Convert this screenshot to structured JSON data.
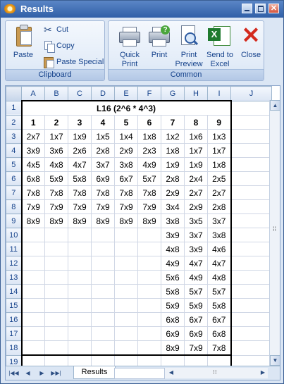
{
  "window": {
    "title": "Results"
  },
  "ribbon": {
    "clipboard": {
      "group_label": "Clipboard",
      "paste": "Paste",
      "cut": "Cut",
      "copy": "Copy",
      "paste_special": "Paste Special"
    },
    "common": {
      "group_label": "Common",
      "quick_print": [
        "Quick",
        "Print"
      ],
      "print": "Print",
      "print_preview": [
        "Print",
        "Preview"
      ],
      "send_to_excel": [
        "Send to",
        "Excel"
      ],
      "close": "Close"
    }
  },
  "sheet": {
    "columns": [
      "A",
      "B",
      "C",
      "D",
      "E",
      "F",
      "G",
      "H",
      "I",
      "J"
    ],
    "rows": [
      "1",
      "2",
      "3",
      "4",
      "5",
      "6",
      "7",
      "8",
      "9",
      "10",
      "11",
      "12",
      "13",
      "14",
      "15",
      "16",
      "17",
      "18",
      "19"
    ],
    "table_title": "L16 (2^6 * 4^3)",
    "header": [
      "1",
      "2",
      "3",
      "4",
      "5",
      "6",
      "7",
      "8",
      "9"
    ],
    "data": [
      [
        "2x7",
        "1x7",
        "1x9",
        "1x5",
        "1x4",
        "1x8",
        "1x2",
        "1x6",
        "1x3"
      ],
      [
        "3x9",
        "3x6",
        "2x6",
        "2x8",
        "2x9",
        "2x3",
        "1x8",
        "1x7",
        "1x7"
      ],
      [
        "4x5",
        "4x8",
        "4x7",
        "3x7",
        "3x8",
        "4x9",
        "1x9",
        "1x9",
        "1x8"
      ],
      [
        "6x8",
        "5x9",
        "5x8",
        "6x9",
        "6x7",
        "5x7",
        "2x8",
        "2x4",
        "2x5"
      ],
      [
        "7x8",
        "7x8",
        "7x8",
        "7x8",
        "7x8",
        "7x8",
        "2x9",
        "2x7",
        "2x7"
      ],
      [
        "7x9",
        "7x9",
        "7x9",
        "7x9",
        "7x9",
        "7x9",
        "3x4",
        "2x9",
        "2x8"
      ],
      [
        "8x9",
        "8x9",
        "8x9",
        "8x9",
        "8x9",
        "8x9",
        "3x8",
        "3x5",
        "3x7"
      ],
      [
        "",
        "",
        "",
        "",
        "",
        "",
        "3x9",
        "3x7",
        "3x8"
      ],
      [
        "",
        "",
        "",
        "",
        "",
        "",
        "4x8",
        "3x9",
        "4x6"
      ],
      [
        "",
        "",
        "",
        "",
        "",
        "",
        "4x9",
        "4x7",
        "4x7"
      ],
      [
        "",
        "",
        "",
        "",
        "",
        "",
        "5x6",
        "4x9",
        "4x8"
      ],
      [
        "",
        "",
        "",
        "",
        "",
        "",
        "5x8",
        "5x7",
        "5x7"
      ],
      [
        "",
        "",
        "",
        "",
        "",
        "",
        "5x9",
        "5x9",
        "5x8"
      ],
      [
        "",
        "",
        "",
        "",
        "",
        "",
        "6x8",
        "6x7",
        "6x7"
      ],
      [
        "",
        "",
        "",
        "",
        "",
        "",
        "6x9",
        "6x9",
        "6x8"
      ],
      [
        "",
        "",
        "",
        "",
        "",
        "",
        "8x9",
        "7x9",
        "7x8"
      ]
    ],
    "tab_label": "Results"
  },
  "icons": {
    "paste": "clipboard-icon",
    "cut": "scissors-icon",
    "copy": "copy-icon",
    "paste_special": "paste-special-icon",
    "quick_print": "printer-icon",
    "print": "printer-question-icon",
    "print_preview": "magnifier-page-icon",
    "send_to_excel": "excel-icon",
    "close": "red-x-icon"
  },
  "colors": {
    "titlebar": "#2f5fa7",
    "ribbon_text": "#15428b",
    "header_bg": "#dbe5f4",
    "excel_green": "#1f7a2e",
    "close_red": "#d32a1e"
  }
}
